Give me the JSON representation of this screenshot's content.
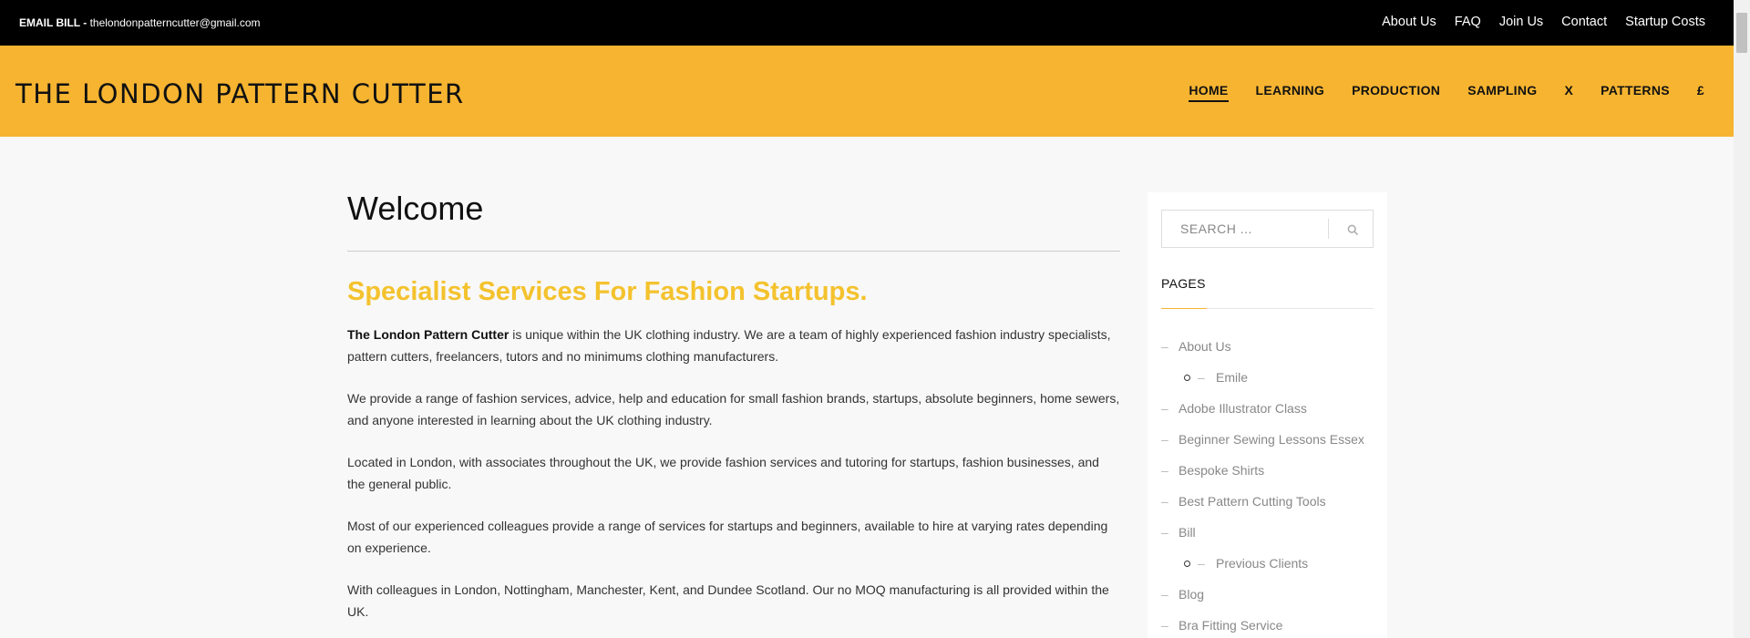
{
  "topbar": {
    "email_label": "EMAIL BILL - ",
    "email_address": "thelondonpatterncutter@gmail.com",
    "links": [
      "About Us",
      "FAQ",
      "Join Us",
      "Contact",
      "Startup Costs"
    ]
  },
  "header": {
    "logo": "THE LONDON PATTERN CUTTER",
    "nav": [
      "HOME",
      "LEARNING",
      "PRODUCTION",
      "SAMPLING",
      "X",
      "PATTERNS",
      "£"
    ],
    "active_nav": "HOME"
  },
  "main": {
    "title": "Welcome",
    "subhead": "Specialist Services For  Fashion Startups.",
    "intro_bold": "The London Pattern Cutter",
    "intro_rest": " is unique within the UK clothing industry. We are a team of  highly experienced  fashion industry specialists, pattern cutters, freelancers, tutors and  no minimums clothing manufacturers.",
    "paragraphs": [
      "We provide a range of fashion services, advice, help and education  for small fashion brands, startups, absolute beginners, home sewers, and anyone  interested in learning about the UK clothing industry.",
      "Located in  London, with associates throughout the UK,  we provide fashion services and tutoring for startups, fashion businesses, and the general public.",
      "Most of our experienced colleagues provide a range of services for startups and beginners, available  to hire at varying rates depending on experience.",
      "With colleagues in London,   Nottingham, Manchester, Kent, and Dundee Scotland. Our no MOQ manufacturing is all provided within the UK."
    ]
  },
  "sidebar": {
    "search_placeholder": "SEARCH ...",
    "pages_title": "PAGES",
    "pages": [
      {
        "label": "About Us",
        "sub": false
      },
      {
        "label": "Emile",
        "sub": true
      },
      {
        "label": "Adobe Illustrator Class",
        "sub": false
      },
      {
        "label": "Beginner Sewing Lessons Essex",
        "sub": false
      },
      {
        "label": "Bespoke Shirts",
        "sub": false
      },
      {
        "label": "Best Pattern Cutting Tools",
        "sub": false
      },
      {
        "label": "Bill",
        "sub": false
      },
      {
        "label": "Previous Clients",
        "sub": true
      },
      {
        "label": "Blog",
        "sub": false
      },
      {
        "label": "Bra Fitting Service",
        "sub": false
      }
    ]
  },
  "colors": {
    "header_bg": "#f6b431",
    "subhead": "#f4c22d",
    "topbar_bg": "#000000"
  },
  "icons": {
    "search": "search-icon"
  }
}
